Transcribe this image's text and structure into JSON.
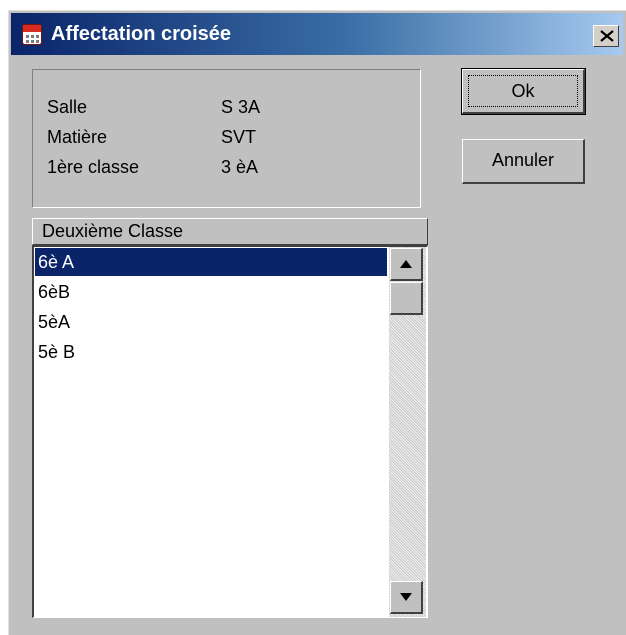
{
  "window": {
    "title": "Affectation croisée",
    "icon": "calendar-icon",
    "close_icon": "close-icon"
  },
  "info": {
    "rows": [
      {
        "label": "Salle",
        "value": "S 3A"
      },
      {
        "label": "Matière",
        "value": "SVT"
      },
      {
        "label": "1ère classe",
        "value": "3 èA"
      }
    ]
  },
  "buttons": {
    "ok_label": "Ok",
    "cancel_label": "Annuler"
  },
  "list": {
    "header": "Deuxième Classe",
    "items": [
      "6è A",
      "6èB",
      "5èA",
      "5è B"
    ],
    "selected_index": 0
  },
  "colors": {
    "selection": "#0a246a",
    "titlebar_start": "#0a246a",
    "titlebar_end": "#a6caf0"
  }
}
